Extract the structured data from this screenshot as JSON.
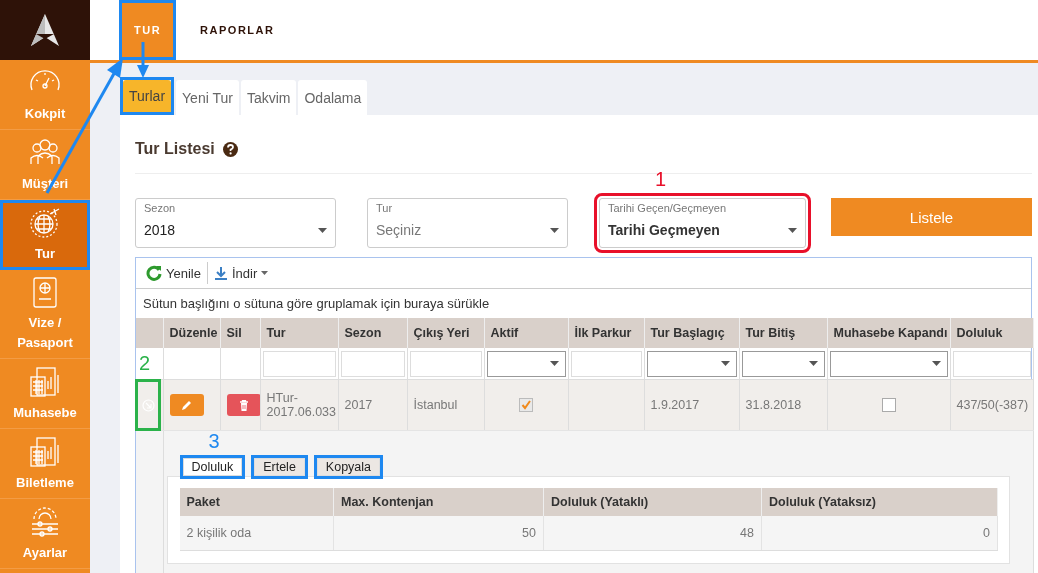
{
  "sidebar": {
    "items": [
      {
        "label": "Kokpit",
        "selected": false
      },
      {
        "label": "Müşteri",
        "selected": false
      },
      {
        "label": "Tur",
        "selected": true,
        "annotation": {
          "color": "#1e88f0"
        }
      },
      {
        "label": "Vize / Pasaport",
        "selected": false
      },
      {
        "label": "Muhasebe",
        "selected": false
      },
      {
        "label": "Biletleme",
        "selected": false
      },
      {
        "label": "Ayarlar",
        "selected": false
      }
    ]
  },
  "top_tabs": [
    {
      "label": "TUR",
      "selected": true,
      "annotation": {
        "color": "#1e88f0"
      }
    },
    {
      "label": "RAPORLAR",
      "selected": false
    }
  ],
  "tabs": [
    {
      "label": "Turlar",
      "selected": true,
      "annotation": {
        "color": "#1e88f0"
      }
    },
    {
      "label": "Yeni Tur",
      "selected": false
    },
    {
      "label": "Takvim",
      "selected": false
    },
    {
      "label": "Odalama",
      "selected": false
    }
  ],
  "section": {
    "title": "Tur Listesi"
  },
  "filters": [
    {
      "label": "Sezon",
      "value": "2018"
    },
    {
      "label": "Tur",
      "placeholder": "Seçiniz"
    },
    {
      "label": "Tarihi Geçen/Geçmeyen",
      "value": "Tarihi Geçmeyen",
      "annotation": {
        "color": "#e8102a",
        "number": "1"
      }
    }
  ],
  "list_button": "Listele",
  "grid": {
    "toolbar": [
      {
        "label": "Yenile",
        "kind": "refresh"
      },
      {
        "label": "İndir",
        "kind": "download"
      }
    ],
    "group_hint": "Sütun başlığını o sütuna göre gruplamak için buraya sürükle",
    "columns": [
      {
        "label": "Düzenle",
        "kind": "edit"
      },
      {
        "label": "Sil",
        "kind": "delete"
      },
      {
        "label": "Tur",
        "kind": "text"
      },
      {
        "label": "Sezon",
        "kind": "text"
      },
      {
        "label": "Çıkış Yeri",
        "kind": "text"
      },
      {
        "label": "Aktif",
        "kind": "check"
      },
      {
        "label": "İlk Parkur",
        "kind": "text"
      },
      {
        "label": "Tur Başlagıç",
        "kind": "text"
      },
      {
        "label": "Tur Bitiş",
        "kind": "text"
      },
      {
        "label": "Muhasebe Kapandı",
        "kind": "check"
      },
      {
        "label": "Doluluk",
        "kind": "text"
      }
    ],
    "filter_row": [
      {
        "kind": "none"
      },
      {
        "kind": "none"
      },
      {
        "kind": "text"
      },
      {
        "kind": "text"
      },
      {
        "kind": "text"
      },
      {
        "kind": "select"
      },
      {
        "kind": "text"
      },
      {
        "kind": "select"
      },
      {
        "kind": "select"
      },
      {
        "kind": "select"
      },
      {
        "kind": "text"
      }
    ],
    "rows": [
      {
        "expanded": true,
        "annotation": {
          "color": "#2bb24a",
          "number": "2"
        },
        "cells": [
          null,
          null,
          "HTur-2017.06.033",
          "2017",
          "İstanbul",
          true,
          null,
          "1.9.2017",
          "31.8.2018",
          false,
          "437/50(-387)"
        ]
      }
    ],
    "detail": {
      "annotation": {
        "color": "#1e88f0",
        "number": "3"
      },
      "buttons": [
        {
          "label": "Doluluk",
          "selected": true,
          "annotation": {
            "color": "#1e88f0"
          }
        },
        {
          "label": "Ertele",
          "selected": false,
          "annotation": {
            "color": "#1e88f0"
          }
        },
        {
          "label": "Kopyala",
          "selected": false,
          "annotation": {
            "color": "#1e88f0"
          }
        }
      ],
      "table": {
        "columns": [
          "Paket",
          "Max. Kontenjan",
          "Doluluk (Yataklı)",
          "Doluluk (Yataksız)"
        ],
        "rows": [
          [
            "2 kişilik oda",
            "50",
            "48",
            "0"
          ]
        ]
      }
    }
  }
}
